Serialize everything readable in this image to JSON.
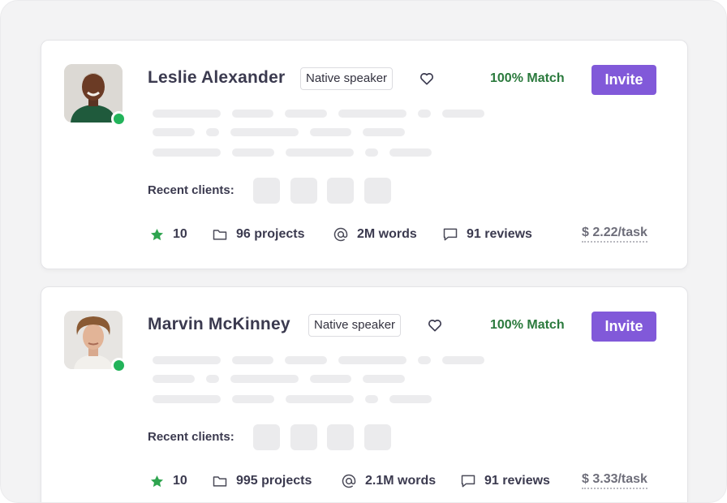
{
  "colors": {
    "accent": "#8159d9",
    "match": "#2b7a3d",
    "online": "#22b35a",
    "star": "#2ea44f"
  },
  "freelancers": [
    {
      "name": "Leslie Alexander",
      "badge": "Native speaker",
      "match": "100% Match",
      "invite_label": "Invite",
      "recent_clients_label": "Recent clients:",
      "rating": "10",
      "projects": "96 projects",
      "words": "2M words",
      "reviews": "91 reviews",
      "price": "$ 2.22/task",
      "online": true
    },
    {
      "name": "Marvin McKinney",
      "badge": "Native speaker",
      "match": "100% Match",
      "invite_label": "Invite",
      "recent_clients_label": "Recent clients:",
      "rating": "10",
      "projects": "995 projects",
      "words": "2.1M words",
      "reviews": "91 reviews",
      "price": "$ 3.33/task",
      "online": true
    }
  ]
}
